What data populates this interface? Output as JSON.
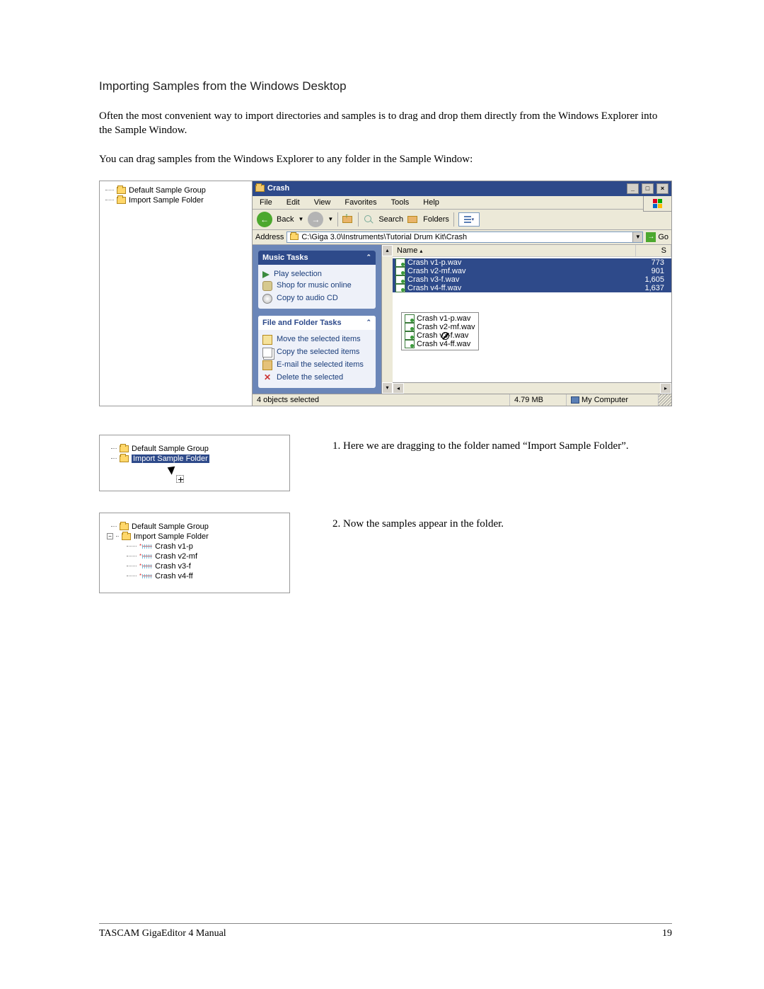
{
  "heading": "Importing Samples from the Windows Desktop",
  "para1": "Often the most convenient way to import directories and samples is to drag and drop them directly from the Windows Explorer into the Sample Window.",
  "para2": "You can drag samples from the Windows Explorer to any folder in the Sample Window:",
  "sample_tree": {
    "item0": "Default Sample Group",
    "item1": "Import Sample Folder"
  },
  "explorer": {
    "title": "Crash",
    "menu": {
      "file": "File",
      "edit": "Edit",
      "view": "View",
      "favorites": "Favorites",
      "tools": "Tools",
      "help": "Help"
    },
    "toolbar": {
      "back": "Back",
      "search": "Search",
      "folders": "Folders"
    },
    "address_label": "Address",
    "address_path": "C:\\Giga 3.0\\Instruments\\Tutorial Drum Kit\\Crash",
    "go": "Go",
    "tasks": {
      "music_head": "Music Tasks",
      "play": "Play selection",
      "shop": "Shop for music online",
      "copycd": "Copy to audio CD",
      "ff_head": "File and Folder Tasks",
      "move": "Move the selected items",
      "copy": "Copy the selected items",
      "email": "E-mail the selected items",
      "delete": "Delete the selected"
    },
    "list": {
      "col_name": "Name",
      "col_s": "S",
      "files": {
        "f0": {
          "name": "Crash v1-p.wav",
          "size": "773"
        },
        "f1": {
          "name": "Crash v2-mf.wav",
          "size": "901"
        },
        "f2": {
          "name": "Crash v3-f.wav",
          "size": "1,605"
        },
        "f3": {
          "name": "Crash v4-ff.wav",
          "size": "1,637"
        }
      },
      "drag": {
        "d0": "Crash v1-p.wav",
        "d1": "Crash v2-mf.wav",
        "d2": "Crash v3-f.wav",
        "d3": "Crash v4-ff.wav"
      }
    },
    "status": {
      "objects": "4 objects selected",
      "size": "4.79 MB",
      "loc": "My Computer"
    }
  },
  "fig2": {
    "caption": "1. Here we are dragging to the folder named “Import Sample Folder”.",
    "item0": "Default Sample Group",
    "item1": "Import Sample Folder"
  },
  "fig3": {
    "caption": "2. Now the samples appear in the folder.",
    "item0": "Default Sample Group",
    "item1": "Import Sample Folder",
    "s0": "Crash v1-p",
    "s1": "Crash v2-mf",
    "s2": "Crash v3-f",
    "s3": "Crash v4-ff"
  },
  "footer": {
    "title": "TASCAM GigaEditor 4 Manual",
    "page": "19"
  }
}
